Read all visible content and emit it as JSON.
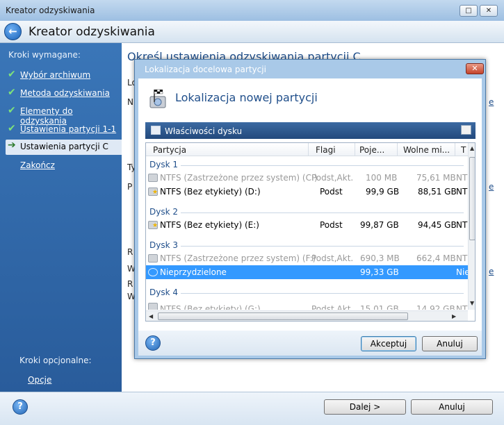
{
  "window": {
    "title": "Kreator odzyskiwania",
    "max_icon": "□",
    "close_icon": "✕"
  },
  "header": {
    "back_icon": "←",
    "title": "Kreator odzyskiwania"
  },
  "sidebar": {
    "required_label": "Kroki wymagane:",
    "items": [
      {
        "label": "Wybór archiwum",
        "icon": "✔"
      },
      {
        "label": "Metoda odzyskiwania",
        "icon": "✔"
      },
      {
        "label": "Elementy do odzyskania",
        "icon": "✔"
      },
      {
        "label": "Ustawienia partycji 1-1",
        "icon": "✔"
      },
      {
        "label": "Ustawienia partycji C",
        "icon": "➔"
      },
      {
        "label": "Zakończ",
        "icon": ""
      }
    ],
    "optional_label": "Kroki opcjonalne:",
    "optional_link": "Opcje"
  },
  "main": {
    "heading": "Określ ustawienia odzyskiwania partycji C",
    "frag_l": "Lo",
    "frag_n": "N",
    "frag_ty": "Ty",
    "frag_p": "P",
    "frag_r": "R",
    "frag_w": "W",
    "frag_r2": "R",
    "frag_w2": "W",
    "link_1": "e",
    "link_2": "e",
    "link_3": "e"
  },
  "dialog": {
    "title": "Lokalizacja docelowa partycji",
    "close_icon": "✕",
    "heading": "Lokalizacja nowej partycji",
    "props_label": "Właściwości dysku",
    "columns": [
      "Partycja",
      "Flagi",
      "Poje...",
      "Wolne mi...",
      "T"
    ],
    "disk1": "Dysk 1",
    "disk2": "Dysk 2",
    "disk3": "Dysk 3",
    "disk4": "Dysk 4",
    "rows": [
      {
        "name": "NTFS (Zastrzeżone przez system) (C:)",
        "flags": "Podst,Akt.",
        "size": "100 MB",
        "free": "75,61 MB",
        "type": "NT"
      },
      {
        "name": "NTFS (Bez etykiety) (D:)",
        "flags": "Podst",
        "size": "99,9 GB",
        "free": "88,51 GB",
        "type": "NT"
      },
      {
        "name": "NTFS (Bez etykiety) (E:)",
        "flags": "Podst",
        "size": "99,87 GB",
        "free": "94,45 GB",
        "type": "NT"
      },
      {
        "name": "NTFS (Zastrzeżone przez system) (F:)",
        "flags": "Podst,Akt.",
        "size": "690,3 MB",
        "free": "662,4 MB",
        "type": "NT"
      },
      {
        "name": "Nieprzydzielone",
        "flags": "",
        "size": "99,33 GB",
        "free": "",
        "type": "Nie"
      },
      {
        "name": "NTFS (Bez etykiety) (G:)",
        "flags": "Podst,Akt.",
        "size": "15,01 GB",
        "free": "14,92 GB",
        "type": "NT"
      }
    ],
    "accept": "Akceptuj",
    "cancel": "Anuluj",
    "help_icon": "?"
  },
  "footer": {
    "next": "Dalej >",
    "cancel": "Anuluj",
    "help_icon": "?"
  }
}
